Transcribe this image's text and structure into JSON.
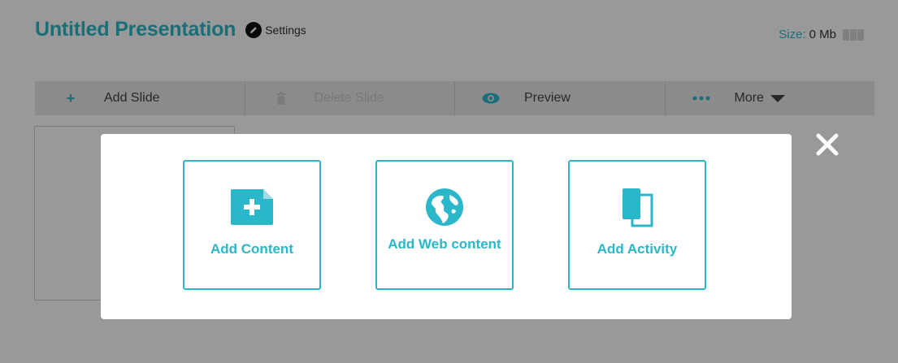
{
  "header": {
    "title": "Untitled Presentation",
    "settings_label": "Settings",
    "size_label": "Size:",
    "size_value": "0 Mb"
  },
  "toolbar": {
    "add_slide": "Add Slide",
    "delete_slide": "Delete Slide",
    "preview": "Preview",
    "more": "More"
  },
  "modal": {
    "options": [
      {
        "label": "Add Content",
        "icon": "add-file-icon"
      },
      {
        "label": "Add Web content",
        "icon": "globe-icon"
      },
      {
        "label": "Add Activity",
        "icon": "activity-icon"
      }
    ]
  },
  "colors": {
    "accent": "#2ab7c9",
    "toolbar_bg": "#e8e8e8",
    "overlay": "rgba(0,0,0,0.4)"
  }
}
